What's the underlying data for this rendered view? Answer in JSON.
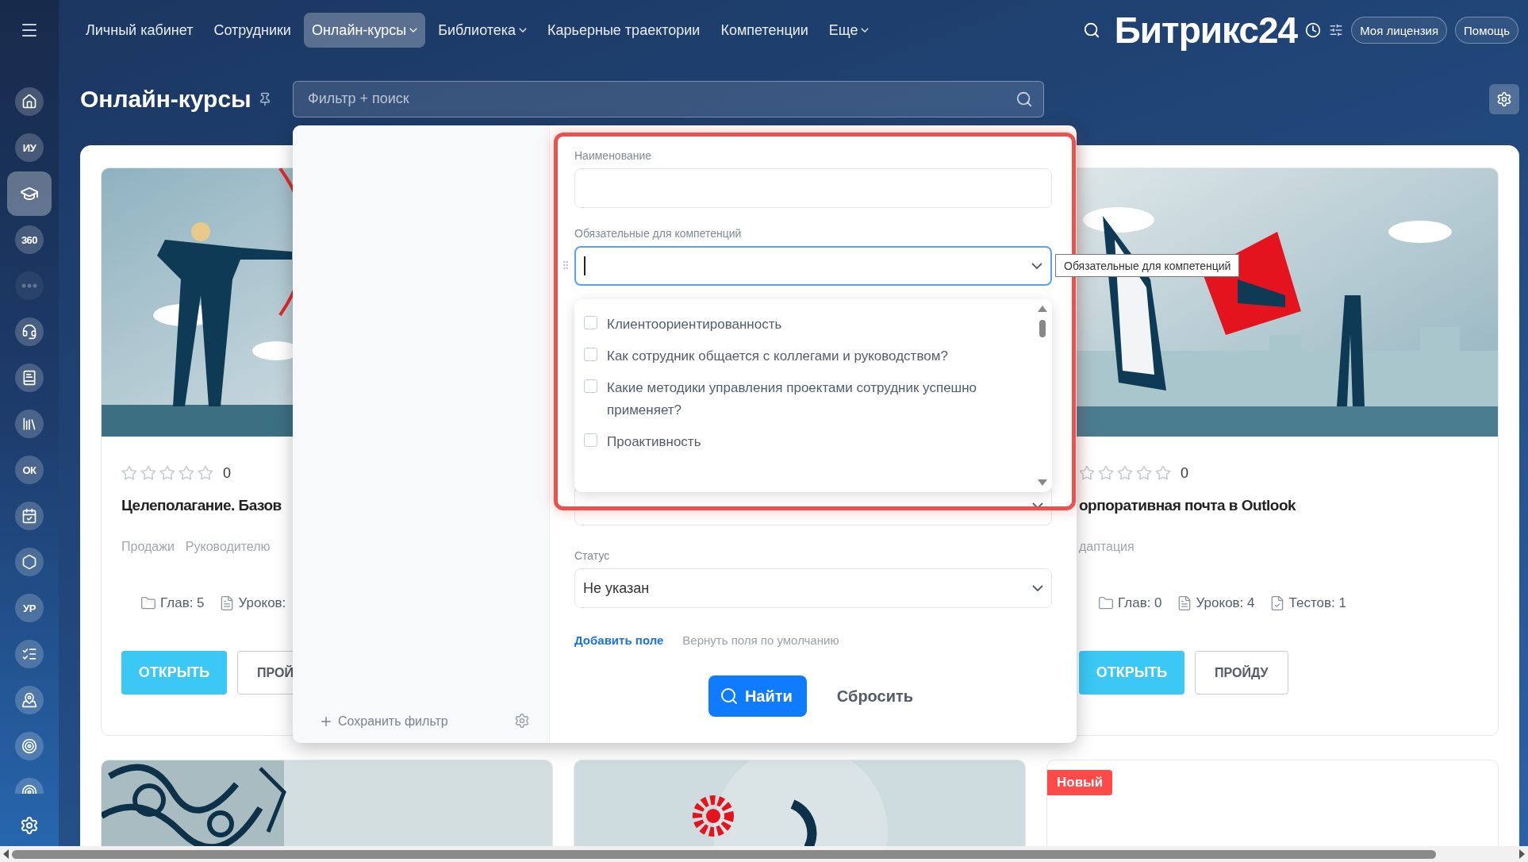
{
  "top_nav": {
    "items": [
      {
        "label": "Личный кабинет",
        "selected": false,
        "has_menu": false
      },
      {
        "label": "Сотрудники",
        "selected": false,
        "has_menu": false
      },
      {
        "label": "Онлайн-курсы",
        "selected": true,
        "has_menu": true
      },
      {
        "label": "Библиотека",
        "selected": false,
        "has_menu": true
      },
      {
        "label": "Карьерные траектории",
        "selected": false,
        "has_menu": false
      },
      {
        "label": "Компетенции",
        "selected": false,
        "has_menu": false
      },
      {
        "label": "Еще",
        "selected": false,
        "has_menu": true
      }
    ]
  },
  "header_right": {
    "logo": "Битрикс24",
    "license_button": "Моя лицензия",
    "help_button": "Помощь"
  },
  "sidebar": {
    "items": [
      {
        "kind": "home",
        "selected": false,
        "disabled": false
      },
      {
        "kind": "initials",
        "label": "ИУ",
        "selected": false,
        "disabled": false
      },
      {
        "kind": "courses",
        "selected": true,
        "disabled": false
      },
      {
        "kind": "initials",
        "label": "360",
        "selected": false,
        "disabled": false
      },
      {
        "kind": "dots",
        "selected": false,
        "disabled": true
      },
      {
        "kind": "support",
        "selected": false,
        "disabled": false
      },
      {
        "kind": "book",
        "selected": false,
        "disabled": false
      },
      {
        "kind": "library",
        "selected": false,
        "disabled": false
      },
      {
        "kind": "initials",
        "label": "ОК",
        "selected": false,
        "disabled": false
      },
      {
        "kind": "calendar",
        "selected": false,
        "disabled": false
      },
      {
        "kind": "hexagon",
        "selected": false,
        "disabled": false
      },
      {
        "kind": "initials",
        "label": "УР",
        "selected": false,
        "disabled": false
      },
      {
        "kind": "checklist",
        "selected": false,
        "disabled": false
      },
      {
        "kind": "map",
        "selected": false,
        "disabled": false
      },
      {
        "kind": "target",
        "selected": false,
        "disabled": false
      },
      {
        "kind": "target",
        "selected": false,
        "disabled": false
      }
    ]
  },
  "page": {
    "title": "Онлайн-курсы",
    "search": {
      "placeholder": "Фильтр + поиск"
    }
  },
  "courses": [
    {
      "stars": 0,
      "rating_count": "0",
      "title": "Целеполагание. Базов",
      "tags": [
        "Продажи",
        "Руководителю"
      ],
      "stats": [
        {
          "kind": "chapters",
          "text": "Глав: 5"
        },
        {
          "kind": "lessons",
          "text": "Уроков:"
        }
      ],
      "open_button": "ОТКРЫТЬ",
      "pass_button": "ПРОЙ"
    },
    {
      "stars": 0,
      "rating_count": "0",
      "title": "орпоративная почта в Outlook",
      "tags": [
        "даптация"
      ],
      "stats": [
        {
          "kind": "chapters",
          "text": "Глав: 0"
        },
        {
          "kind": "lessons",
          "text": "Уроков: 4"
        },
        {
          "kind": "tests",
          "text": "Тестов: 1"
        }
      ],
      "open_button": "ОТКРЫТЬ",
      "pass_button": "ПРОЙДУ"
    }
  ],
  "more_courses": [
    {
      "kind": "picture"
    },
    {
      "kind": "picture"
    },
    {
      "kind": "badge",
      "badge": "Новый"
    }
  ],
  "filter": {
    "save_filter": "Сохранить фильтр",
    "fields": [
      {
        "kind": "text",
        "label": "Наименование"
      },
      {
        "kind": "multiselect",
        "label": "Обязательные для компетенций",
        "focused": true,
        "expanded": true,
        "options": [
          {
            "label": "Клиентоориентированность",
            "checked": false
          },
          {
            "label": "Как сотрудник общается с коллегами и руководством?",
            "checked": false
          },
          {
            "label": "Какие методики управления проектами сотрудник успешно применяет?",
            "checked": false
          },
          {
            "label": "Проактивность",
            "checked": false
          }
        ]
      },
      {
        "kind": "select"
      },
      {
        "kind": "select",
        "label": "Статус",
        "value": "Не указан"
      }
    ],
    "add_field": "Добавить поле",
    "reset_fields": "Вернуть поля по умолчанию",
    "find_button": "Найти",
    "reset_button": "Сбросить",
    "tooltip": "Обязательные для компетенций"
  }
}
